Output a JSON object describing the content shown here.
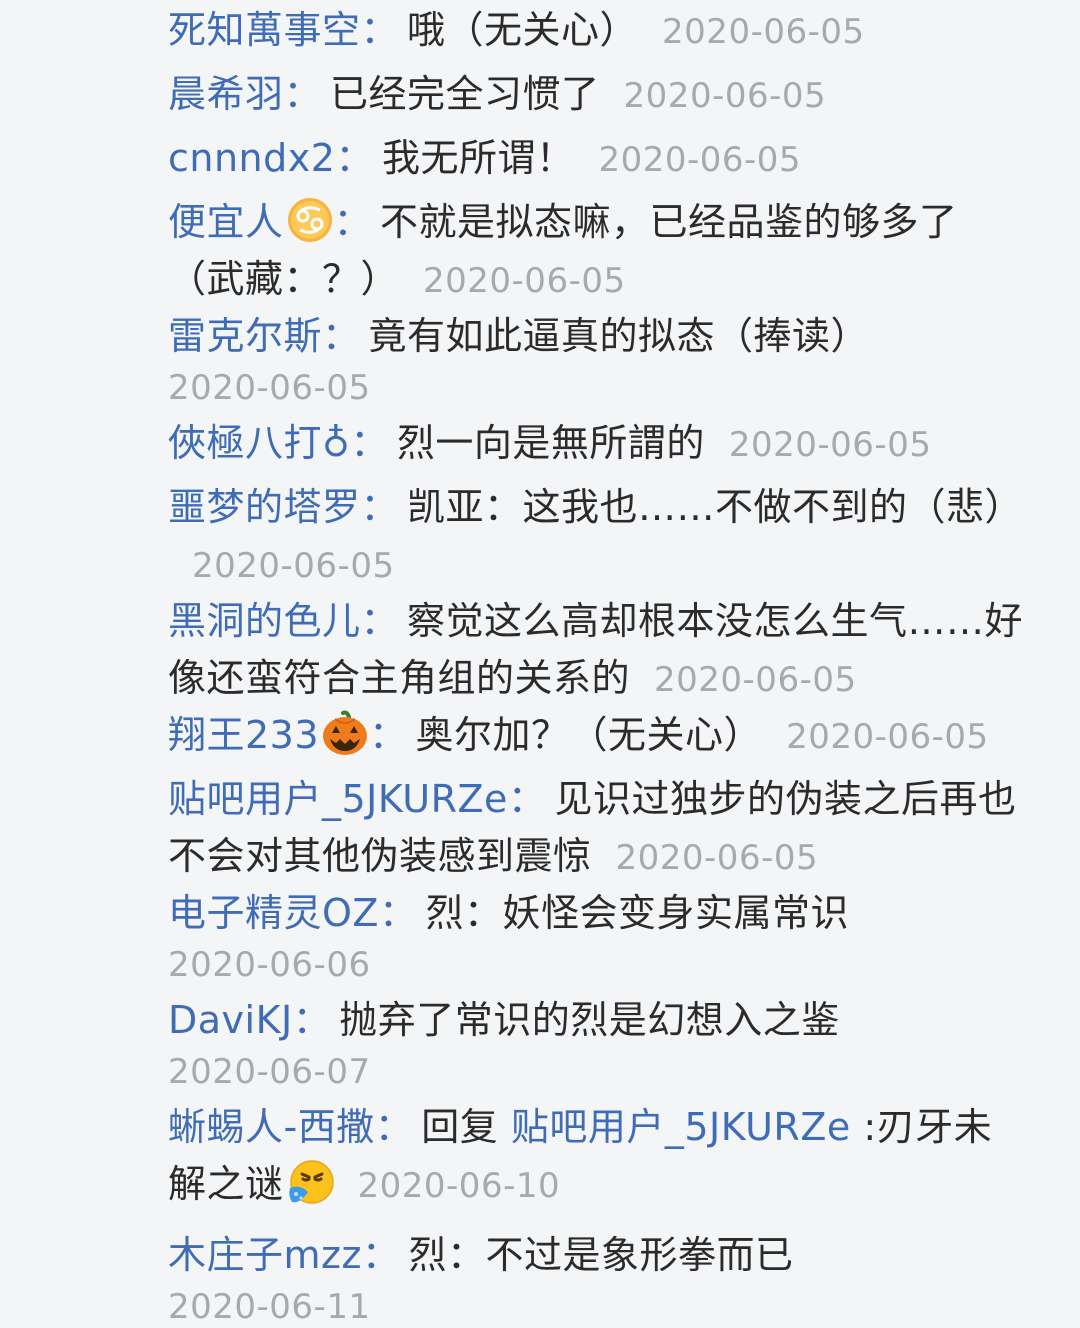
{
  "replies": [
    {
      "user": "死知萬事空",
      "colon": "：",
      "text": "哦（无关心）",
      "date": "2020-06-05"
    },
    {
      "user": "晨希羽",
      "colon": "：",
      "text": "已经完全习惯了",
      "date": "2020-06-05"
    },
    {
      "user": "cnnndx2",
      "colon": "：",
      "text": "我无所谓！",
      "date": "2020-06-05"
    },
    {
      "user": "便宜人",
      "colon": "：",
      "text": "不就是拟态嘛，已经品鉴的够多了（武藏：？）",
      "date": "2020-06-05",
      "badge_icon": "cancer-zodiac-icon"
    },
    {
      "user": "雷克尔斯",
      "colon": "：",
      "text": "竟有如此逼真的拟态（捧读）",
      "date": "2020-06-05"
    },
    {
      "user": "俠極八打♁",
      "colon": "：",
      "text": "烈一向是無所謂的",
      "date": "2020-06-05"
    },
    {
      "user": "噩梦的塔罗",
      "colon": "：",
      "text": "凯亚：这我也……不做不到的（悲）",
      "date": "2020-06-05"
    },
    {
      "user": "黑洞的色儿",
      "colon": "：",
      "text": "察觉这么高却根本没怎么生气……好像还蛮符合主角组的关系的",
      "date": "2020-06-05"
    },
    {
      "user": "翔王233",
      "colon": "：",
      "text": "奥尔加？（无关心）",
      "date": "2020-06-05",
      "badge_icon": "jack-o-lantern-icon"
    },
    {
      "user": "贴吧用户_5JKURZe",
      "colon": "：",
      "text": "见识过独步的伪装之后再也不会对其他伪装感到震惊",
      "date": "2020-06-05"
    },
    {
      "user": "电子精灵OZ",
      "colon": "：",
      "text": "烈：妖怪会变身实属常识",
      "date": "2020-06-06"
    },
    {
      "user": "DaviKJ",
      "colon": "：",
      "text": "抛弃了常识的烈是幻想入之鉴",
      "date": "2020-06-07"
    },
    {
      "user": "蜥蜴人-西撒",
      "colon": "：",
      "reply_prefix": "回复 ",
      "reply_to": "贴吧用户_5JKURZe",
      "text": " :刃牙未解之谜",
      "date": "2020-06-10",
      "trailing_icon": "vomiting-face-emoji-icon"
    },
    {
      "user": "木庄子mzz",
      "colon": "：",
      "text": "烈：不过是象形拳而已",
      "date": "2020-06-11"
    }
  ]
}
